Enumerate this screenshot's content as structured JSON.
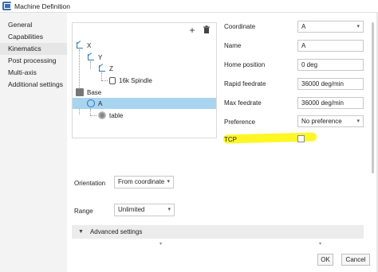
{
  "window": {
    "title": "Machine Definition"
  },
  "sidebar": {
    "items": [
      {
        "label": "General"
      },
      {
        "label": "Capabilities"
      },
      {
        "label": "Kinematics"
      },
      {
        "label": "Post processing"
      },
      {
        "label": "Multi-axis"
      },
      {
        "label": "Additional settings"
      }
    ],
    "selected": "Kinematics"
  },
  "tree": {
    "toolbar": {
      "add": "+",
      "delete": "🗑"
    },
    "nodes": [
      {
        "label": "X",
        "icon": "axis-icon"
      },
      {
        "label": "Y",
        "icon": "axis-icon"
      },
      {
        "label": "Z",
        "icon": "axis-icon"
      },
      {
        "label": "16k Spindle",
        "icon": "spindle-icon"
      },
      {
        "label": "Base",
        "icon": "base-icon"
      },
      {
        "label": "A",
        "icon": "rotary-axis-icon",
        "selected": true
      },
      {
        "label": "table",
        "icon": "table-icon"
      }
    ]
  },
  "properties": {
    "coordinate": {
      "label": "Coordinate",
      "value": "A"
    },
    "name": {
      "label": "Name",
      "value": "A"
    },
    "home_position": {
      "label": "Home position",
      "value": "0 deg"
    },
    "rapid_feedrate": {
      "label": "Rapid feedrate",
      "value": "36000 deg/min"
    },
    "max_feedrate": {
      "label": "Max feedrate",
      "value": "36000 deg/min"
    },
    "preference": {
      "label": "Preference",
      "value": "No preference"
    },
    "tcp": {
      "label": "TCP",
      "checked": false
    }
  },
  "orientation": {
    "label": "Orientation",
    "value": "From coordinate"
  },
  "range": {
    "label": "Range",
    "value": "Unlimited"
  },
  "advanced": {
    "label": "Advanced settings"
  },
  "footer": {
    "ok": "OK",
    "cancel": "Cancel"
  },
  "colors": {
    "selection": "#a8d4f0",
    "highlight": "#fff500",
    "nav_bg": "#f3f3f3"
  }
}
